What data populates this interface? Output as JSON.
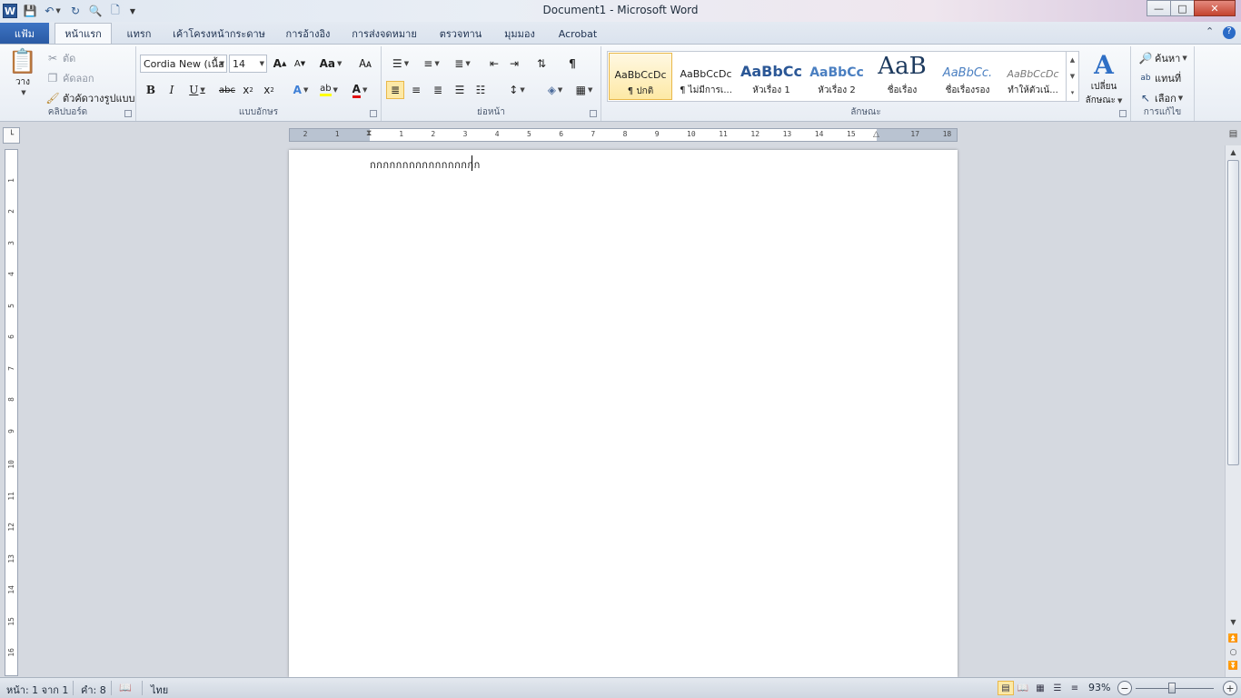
{
  "window": {
    "title": "Document1 - Microsoft Word"
  },
  "tabs": {
    "file": "แฟ้ม",
    "home": "หน้าแรก",
    "insert": "แทรก",
    "layout": "เค้าโครงหน้ากระดาษ",
    "references": "การอ้างอิง",
    "mailings": "การส่งจดหมาย",
    "review": "ตรวจทาน",
    "view": "มุมมอง",
    "acrobat": "Acrobat"
  },
  "clipboard": {
    "paste": "วาง",
    "cut": "ตัด",
    "copy": "คัดลอก",
    "format_painter": "ตัวคัดวางรูปแบบ",
    "label": "คลิปบอร์ด"
  },
  "font": {
    "name": "Cordia New (เนื้อ",
    "size": "14",
    "label": "แบบอักษร",
    "change_case": "Aa"
  },
  "paragraph": {
    "label": "ย่อหน้า"
  },
  "styles": {
    "label": "ลักษณะ",
    "items": [
      {
        "preview": "AaBbCcDc",
        "name": "¶ ปกติ"
      },
      {
        "preview": "AaBbCcDc",
        "name": "¶ ไม่มีการเ..."
      },
      {
        "preview": "AaBbCc",
        "name": "หัวเรื่อง 1"
      },
      {
        "preview": "AaBbCc",
        "name": "หัวเรื่อง 2"
      },
      {
        "preview": "AaB",
        "name": "ชื่อเรื่อง"
      },
      {
        "preview": "AaBbCc.",
        "name": "ชื่อเรื่องรอง"
      },
      {
        "preview": "AaBbCcDc",
        "name": "ทำให้ตัวเน้..."
      }
    ],
    "change_styles_line1": "เปลี่ยน",
    "change_styles_line2": "ลักษณะ"
  },
  "editing": {
    "label": "การแก้ไข",
    "find": "ค้นหา",
    "replace": "แทนที่",
    "select": "เลือก"
  },
  "ruler": {
    "h_ticks": [
      "2",
      "1",
      "1",
      "2",
      "3",
      "4",
      "5",
      "6",
      "7",
      "8",
      "9",
      "10",
      "11",
      "12",
      "13",
      "14",
      "15",
      "17",
      "18"
    ],
    "v_ticks": [
      "1",
      "2",
      "3",
      "4",
      "5",
      "6",
      "7",
      "8",
      "9",
      "10",
      "11",
      "12",
      "13",
      "14",
      "15",
      "16"
    ]
  },
  "document": {
    "body_text": "กกกกกกกกกกกกกกกกก"
  },
  "status": {
    "page": "หน้า: 1 จาก 1",
    "words": "คำ: 8",
    "language": "ไทย",
    "zoom": "93%"
  },
  "zoom_level": 0.93,
  "colors": {
    "file_tab": "#2a5aa4",
    "highlight": "#ffff00",
    "font_color": "#e01010",
    "selected_style": "#fde9a6"
  }
}
